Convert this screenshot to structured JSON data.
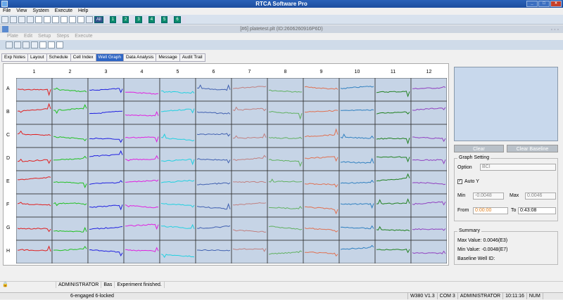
{
  "app": {
    "title": "RTCA Software Pro"
  },
  "menu": [
    "File",
    "View",
    "System",
    "Execute",
    "Help"
  ],
  "toolbar": {
    "a_label": "All",
    "nums": [
      "1",
      "2",
      "3",
      "4",
      "5",
      "6"
    ]
  },
  "child": {
    "title": "[#6] platetest.plt (ID:2606260916P6D)"
  },
  "menu2": [
    "Plate",
    "Edit",
    "Setup",
    "Steps",
    "Execute"
  ],
  "tabs": [
    "Exp Notes",
    "Layout",
    "Schedule",
    "Cell Index",
    "Well Graph",
    "Data Analysis",
    "Message",
    "Audit Trail"
  ],
  "active_tab": "Well Graph",
  "graph": {
    "columns": [
      "1",
      "2",
      "3",
      "4",
      "5",
      "6",
      "7",
      "8",
      "9",
      "10",
      "11",
      "12"
    ],
    "rows": [
      "A",
      "B",
      "C",
      "D",
      "E",
      "F",
      "G",
      "H"
    ],
    "col_colors": [
      "#e02020",
      "#20c020",
      "#2020e0",
      "#e020e0",
      "#20d0e0",
      "#4060b0",
      "#c08080",
      "#60b060",
      "#e07050",
      "#3080c0",
      "#208020",
      "#9040c0"
    ]
  },
  "panel": {
    "clear": "Clear",
    "clear_baseline": "Clear Baseline",
    "graph_setting": "Graph Setting",
    "option_label": "Option",
    "option_value": "BCI",
    "auto_y": "Auto Y",
    "min_label": "Min",
    "min_value": "-0.0048",
    "max_label": "Max",
    "max_value": "0.0046",
    "from_label": "From",
    "from_value": "0:00:00",
    "to_label": "To",
    "to_value": "0:43:08",
    "summary": "Summary",
    "max_value_text": "Max Value: 0.0046(E3)",
    "min_value_text": "Min Value: -0.0048(E7)",
    "baseline_text": "Baseline Well ID:"
  },
  "status": {
    "user": "ADMINISTRATOR",
    "mode": "Bas",
    "message": "Experiment finished."
  },
  "status2": {
    "engaged": "6-engaged 6-locked",
    "version": "W380 V1.3",
    "com": "COM 3",
    "user": "ADMINISTRATOR",
    "time": "10:11:16",
    "num": "NUM"
  }
}
